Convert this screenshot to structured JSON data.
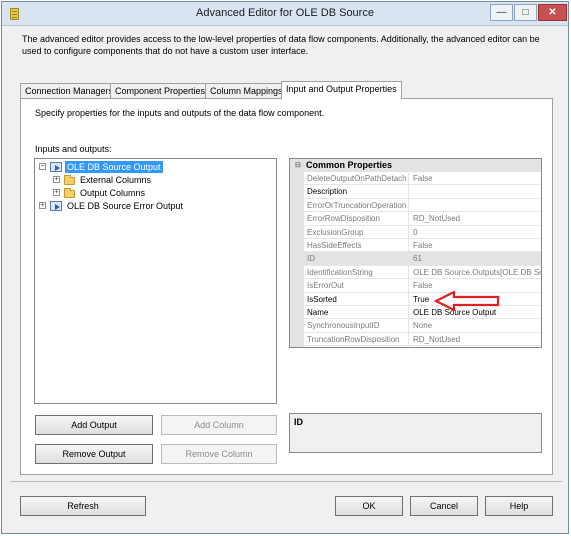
{
  "window": {
    "title": "Advanced Editor for OLE DB Source",
    "minimize_glyph": "—",
    "maximize_glyph": "□",
    "close_glyph": "✕"
  },
  "description": "The advanced editor provides access to the low-level properties of data flow components. Additionally, the advanced editor can be used to configure components that do not have a custom user interface.",
  "tabs": [
    {
      "label": "Connection Managers"
    },
    {
      "label": "Component Properties"
    },
    {
      "label": "Column Mappings"
    },
    {
      "label": "Input and Output Properties",
      "active": true
    }
  ],
  "panel": {
    "description": "Specify properties for the inputs and outputs of the data flow component.",
    "tree_label": "Inputs and outputs:",
    "tree": [
      {
        "label": "OLE DB Source Output",
        "expander": "−",
        "selected": true
      },
      {
        "label": "External Columns",
        "expander": "+"
      },
      {
        "label": "Output Columns",
        "expander": "+"
      },
      {
        "label": "OLE DB Source Error Output",
        "expander": "+"
      }
    ],
    "buttons": {
      "add_output": "Add Output",
      "add_column": "Add Column",
      "remove_output": "Remove Output",
      "remove_column": "Remove Column"
    },
    "grid": {
      "category": "Common Properties",
      "collapse_glyph": "⊟",
      "properties": [
        {
          "name": "DeleteOutputOnPathDetach",
          "value": "False",
          "editable": false
        },
        {
          "name": "Description",
          "value": "",
          "editable": true
        },
        {
          "name": "ErrorOrTruncationOperation",
          "value": "",
          "editable": false
        },
        {
          "name": "ErrorRowDisposition",
          "value": "RD_NotUsed",
          "editable": false
        },
        {
          "name": "ExclusionGroup",
          "value": "0",
          "editable": false
        },
        {
          "name": "HasSideEffects",
          "value": "False",
          "editable": false
        },
        {
          "name": "ID",
          "value": "61",
          "editable": false,
          "selected": true
        },
        {
          "name": "IdentificationString",
          "value": "OLE DB Source.Outputs[OLE DB Sou",
          "editable": false
        },
        {
          "name": "IsErrorOut",
          "value": "False",
          "editable": false
        },
        {
          "name": "IsSorted",
          "value": "True",
          "editable": true
        },
        {
          "name": "Name",
          "value": "OLE DB Source Output",
          "editable": true
        },
        {
          "name": "SynchronousInputID",
          "value": "None",
          "editable": false
        },
        {
          "name": "TruncationRowDisposition",
          "value": "RD_NotUsed",
          "editable": false
        }
      ]
    },
    "help_title": "ID"
  },
  "footer": {
    "refresh": "Refresh",
    "ok": "OK",
    "cancel": "Cancel",
    "help": "Help"
  },
  "colors": {
    "annotation_arrow": "#e02020",
    "selection": "#3399ff"
  }
}
